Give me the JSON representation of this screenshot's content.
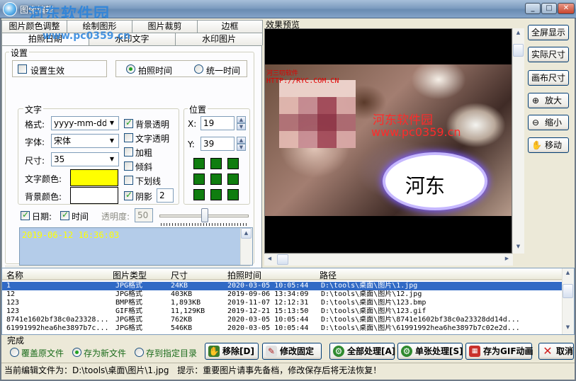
{
  "window": {
    "title": "图像编辑",
    "watermark_site": "河东软件园",
    "watermark_url": "www.pc0359.cn",
    "buttons": {
      "minimize": "_",
      "maximize": "□",
      "close": "✕"
    }
  },
  "tabs": {
    "row1": [
      "图片颜色调整",
      "绘制图形",
      "图片裁剪",
      "边框"
    ],
    "row2": [
      "拍照日期",
      "水印文字",
      "水印图片"
    ],
    "active": "拍照日期"
  },
  "settings": {
    "legend": "设置",
    "enable_label": "设置生效",
    "enable_checked": false,
    "time_mode": {
      "option1": "拍照时间",
      "option2": "统一时间",
      "selected": "拍照时间"
    },
    "text": {
      "legend": "文字",
      "format_label": "格式:",
      "format_value": "yyyy-mm-dd",
      "font_label": "字体:",
      "font_value": "宋体",
      "size_label": "尺寸:",
      "size_value": "35",
      "text_color_label": "文字颜色:",
      "text_color": "#ffff00",
      "bg_color_label": "背景颜色:",
      "bg_color": "#ffffff",
      "bg_transparent": "背景透明",
      "bg_transparent_checked": true,
      "text_transparent": "文字透明",
      "text_transparent_checked": false,
      "bold": "加粗",
      "bold_checked": false,
      "italic": "倾斜",
      "italic_checked": false,
      "underline": "下划线",
      "underline_checked": false,
      "shadow": "阴影",
      "shadow_checked": true,
      "shadow_value": "2"
    },
    "position": {
      "legend": "位置",
      "x_label": "X:",
      "x_value": "19",
      "y_label": "Y:",
      "y_value": "39",
      "anchor_color": "#0f7d0f"
    },
    "date_label": "日期:",
    "date_checked": true,
    "time_label": "时间",
    "time_checked": true,
    "opacity_label": "透明度:",
    "opacity_value": "50",
    "opacity_slider": 0.5,
    "memo_text": "2019-06-12 16:36:03"
  },
  "preview": {
    "label": "效果预览",
    "overlay_small1": "河三叨软件",
    "overlay_small2": "HTTP://RYC.COM.CN",
    "overlay_red1": "河东软件园",
    "overlay_red2": "www.pc0359.cn",
    "bubble_text": "河东"
  },
  "side_buttons": [
    "全屏显示",
    "实际尺寸",
    "画布尺寸",
    "放大",
    "缩小",
    "移动"
  ],
  "table": {
    "headers": [
      "名称",
      "图片类型",
      "尺寸",
      "拍照时间",
      "路径"
    ],
    "rows": [
      [
        "1",
        "JPG格式",
        "24KB",
        "2020-03-05 10:05:44",
        "D:\\tools\\桌面\\图片\\1.jpg"
      ],
      [
        "12",
        "JPG格式",
        "403KB",
        "2019-09-06 13:34:09",
        "D:\\tools\\桌面\\图片\\12.jpg"
      ],
      [
        "123",
        "BMP格式",
        "1,893KB",
        "2019-11-07 12:12:31",
        "D:\\tools\\桌面\\图片\\123.bmp"
      ],
      [
        "123",
        "GIF格式",
        "11,129KB",
        "2019-12-21 15:13:50",
        "D:\\tools\\桌面\\图片\\123.gif"
      ],
      [
        "8741e1602bf38c0a23328...",
        "JPG格式",
        "762KB",
        "2020-03-05 10:05:44",
        "D:\\tools\\桌面\\图片\\8741e1602bf38c0a23328dd14d..."
      ],
      [
        "61991992hea6he3897b7c...",
        "JPG格式",
        "546KB",
        "2020-03-05 10:05:44",
        "D:\\tools\\桌面\\图片\\61991992hea6he3897b7c02e2d..."
      ]
    ],
    "selected_row": 0
  },
  "bottom": {
    "done_label": "完成",
    "options": [
      "覆盖原文件",
      "存为新文件",
      "存到指定目录"
    ],
    "selected_option": "存为新文件",
    "remove": "移除[D]",
    "fix": "修改固定",
    "process_all": "全部处理[A]",
    "process_single": "单张处理[S]",
    "save_gif": "存为GIF动画",
    "cancel": "取消"
  },
  "status": {
    "current_file": "当前编辑文件为：D:\\tools\\桌面\\图片\\1.jpg",
    "tip": "提示：重要图片请事先备档，修改保存后将无法恢复！"
  }
}
